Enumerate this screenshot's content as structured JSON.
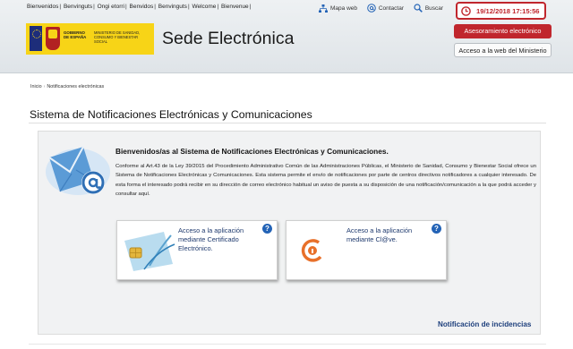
{
  "header": {
    "languages": [
      "Bienvenidos",
      "Benvinguts",
      "Ongi etorri",
      "Benvidos",
      "Benvinguts",
      "Welcome",
      "Bienvenue"
    ],
    "top_links": {
      "sitemap": "Mapa web",
      "contact": "Contactar",
      "search": "Buscar"
    },
    "datetime": "19/12/2018 17:15:56",
    "logo": {
      "gobierno": "GOBIERNO DE ESPAÑA",
      "ministerio": "MINISTERIO DE SANIDAD, CONSUMO Y BIENESTAR SOCIAL"
    },
    "site_title": "Sede Electrónica",
    "advice_button": "Asesoramiento electrónico",
    "ministry_button": "Acceso a la web del Ministerio"
  },
  "breadcrumb": {
    "home": "Inicio",
    "current": "Notificaciones electrónicas"
  },
  "page_title": "Sistema de Notificaciones Electrónicas y Comunicaciones",
  "main": {
    "welcome": "Bienvenidos/as al Sistema de Notificaciones Electrónicas y Comunicaciones.",
    "intro": "Conforme al Art.43 de la Ley 39/2015 del Procedimiento Administrativo Común de las Administraciones Públicas, el Ministerio de Sanidad, Consumo y Bienestar Social ofrece un Sistema de Notificaciones Electrónicas y Comunicaciones. Esta sistema permite el envío de notificaciones por parte de centros directivos notificadores a cualquier interesado. De esta forma el interesado podrá recibir en su dirección de correo electrónico habitual un aviso de puesta a su disposición de una notificación/comunicación a la que podrá acceder y consultar aquí.",
    "cards": [
      {
        "label": "Acceso a la aplicación mediante Certificado Electrónico.",
        "help": "?"
      },
      {
        "label": "Acceso a la aplicación mediante Cl@ve.",
        "help": "?"
      }
    ],
    "incidents_link": "Notificación de incidencias"
  },
  "colors": {
    "accent_red": "#c0262d",
    "link_blue": "#1d3f7c",
    "help_blue": "#2363b6",
    "logo_yellow": "#f7d417"
  }
}
